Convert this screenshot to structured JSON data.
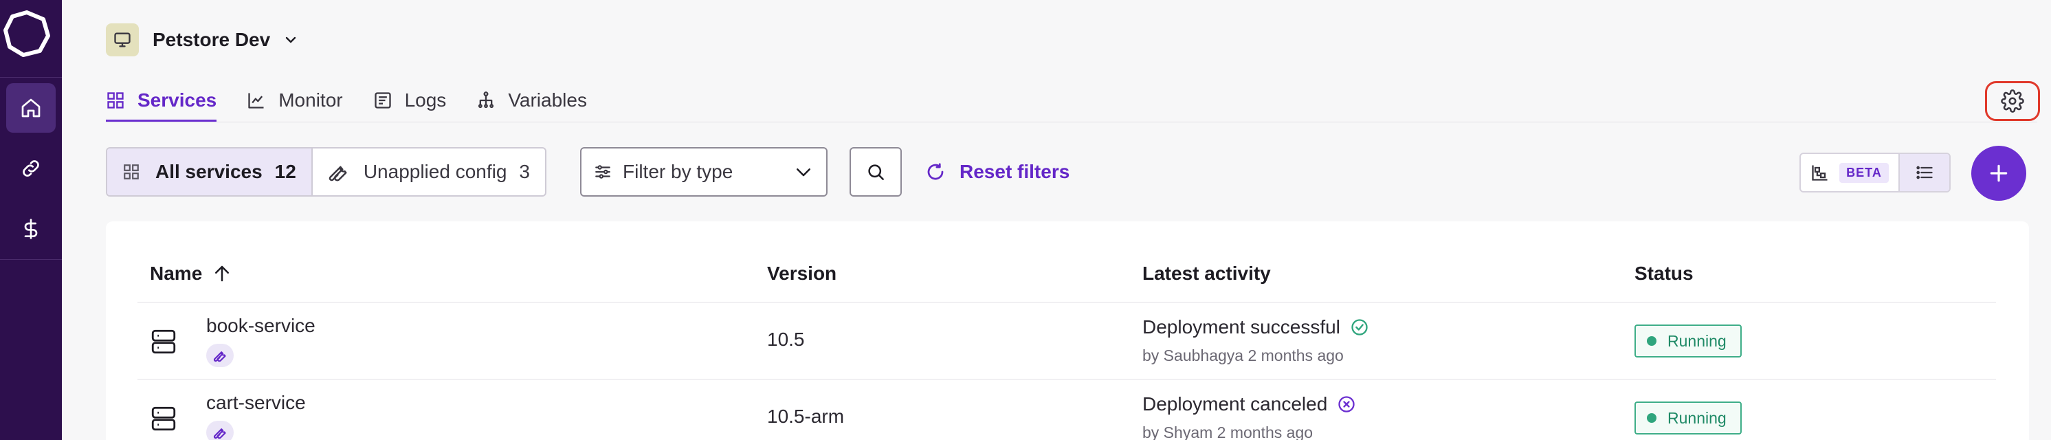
{
  "project": {
    "name": "Petstore Dev"
  },
  "tabs": [
    {
      "label": "Services",
      "active": true,
      "icon": "grid-icon"
    },
    {
      "label": "Monitor",
      "active": false,
      "icon": "chart-line-icon"
    },
    {
      "label": "Logs",
      "active": false,
      "icon": "logs-icon"
    },
    {
      "label": "Variables",
      "active": false,
      "icon": "variables-icon"
    }
  ],
  "toolbar": {
    "all_services_label": "All services",
    "all_services_count": "12",
    "unapplied_label": "Unapplied config",
    "unapplied_count": "3",
    "filter_placeholder": "Filter by type",
    "reset_label": "Reset filters",
    "beta_label": "BETA"
  },
  "table": {
    "headers": {
      "name": "Name",
      "version": "Version",
      "activity": "Latest activity",
      "status": "Status"
    },
    "rows": [
      {
        "name": "book-service",
        "version": "10.5",
        "activity": "Deployment successful",
        "activity_sub": "by Saubhagya 2 months ago",
        "activity_icon": "check-circle-icon",
        "status": "Running"
      },
      {
        "name": "cart-service",
        "version": "10.5-arm",
        "activity": "Deployment canceled",
        "activity_sub": "by Shyam 2 months ago",
        "activity_icon": "x-circle-icon",
        "status": "Running"
      }
    ]
  },
  "colors": {
    "sidebar": "#2d0f4d",
    "accent": "#6b2fd0",
    "success": "#2fa57d",
    "highlight": "#e0392b"
  }
}
